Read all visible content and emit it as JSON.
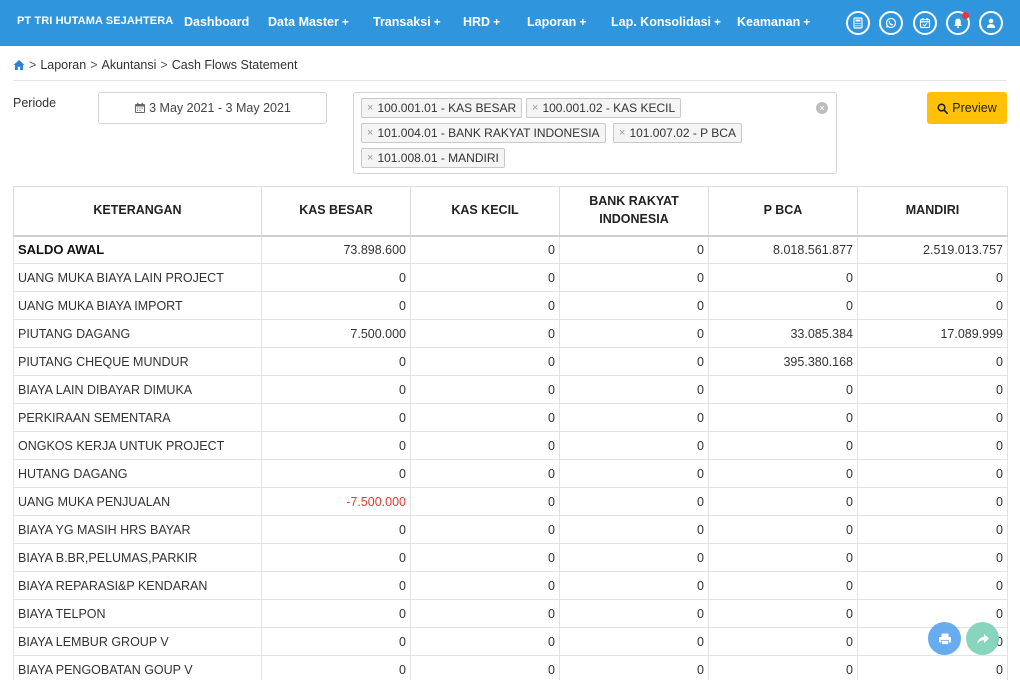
{
  "navbar": {
    "brand": "PT TRI HUTAMA SEJAHTERA",
    "items": [
      {
        "label": "Dashboard",
        "plus": ""
      },
      {
        "label": "Data Master",
        "plus": "+"
      },
      {
        "label": "Transaksi",
        "plus": "+"
      },
      {
        "label": "HRD",
        "plus": "+"
      },
      {
        "label": "Laporan",
        "plus": "+"
      },
      {
        "label": "Lap. Konsolidasi",
        "plus": "+"
      },
      {
        "label": "Keamanan",
        "plus": "+"
      }
    ],
    "icons": [
      "calculator-icon",
      "whatsapp-icon",
      "calendar-check-icon",
      "bell-icon",
      "user-icon"
    ]
  },
  "breadcrumb": {
    "home_icon": "home-icon",
    "items": [
      "Laporan",
      "Akuntansi",
      "Cash Flows Statement"
    ],
    "separator": ">"
  },
  "filters": {
    "periode_label": "Periode",
    "date_range": "3 May 2021 - 3 May 2021",
    "accounts": [
      "100.001.01 - KAS BESAR",
      "100.001.02 - KAS KECIL",
      "101.004.01 - BANK RAKYAT INDONESIA",
      "101.007.02 - P BCA",
      "101.008.01 - MANDIRI"
    ],
    "remove_symbol": "×",
    "clear_symbol": "×",
    "preview_label": "Preview"
  },
  "table": {
    "headers": [
      "KETERANGAN",
      "KAS BESAR",
      "KAS KECIL",
      "BANK RAKYAT INDONESIA",
      "P BCA",
      "MANDIRI"
    ],
    "rows": [
      {
        "label": "SALDO AWAL",
        "values": [
          "73.898.600",
          "0",
          "0",
          "8.018.561.877",
          "2.519.013.757"
        ],
        "bold": true
      },
      {
        "label": "UANG MUKA BIAYA LAIN PROJECT",
        "values": [
          "0",
          "0",
          "0",
          "0",
          "0"
        ]
      },
      {
        "label": "UANG MUKA BIAYA IMPORT",
        "values": [
          "0",
          "0",
          "0",
          "0",
          "0"
        ]
      },
      {
        "label": "PIUTANG DAGANG",
        "values": [
          "7.500.000",
          "0",
          "0",
          "33.085.384",
          "17.089.999"
        ]
      },
      {
        "label": "PIUTANG CHEQUE MUNDUR",
        "values": [
          "0",
          "0",
          "0",
          "395.380.168",
          "0"
        ]
      },
      {
        "label": "BIAYA LAIN DIBAYAR DIMUKA",
        "values": [
          "0",
          "0",
          "0",
          "0",
          "0"
        ]
      },
      {
        "label": "PERKIRAAN SEMENTARA",
        "values": [
          "0",
          "0",
          "0",
          "0",
          "0"
        ]
      },
      {
        "label": "ONGKOS KERJA UNTUK PROJECT",
        "values": [
          "0",
          "0",
          "0",
          "0",
          "0"
        ]
      },
      {
        "label": "HUTANG DAGANG",
        "values": [
          "0",
          "0",
          "0",
          "0",
          "0"
        ]
      },
      {
        "label": "UANG MUKA PENJUALAN",
        "values": [
          "-7.500.000",
          "0",
          "0",
          "0",
          "0"
        ]
      },
      {
        "label": "BIAYA YG MASIH HRS BAYAR",
        "values": [
          "0",
          "0",
          "0",
          "0",
          "0"
        ]
      },
      {
        "label": "BIAYA B.BR,PELUMAS,PARKIR",
        "values": [
          "0",
          "0",
          "0",
          "0",
          "0"
        ]
      },
      {
        "label": "BIAYA REPARASI&P KENDARAN",
        "values": [
          "0",
          "0",
          "0",
          "0",
          "0"
        ]
      },
      {
        "label": "BIAYA TELPON",
        "values": [
          "0",
          "0",
          "0",
          "0",
          "0"
        ]
      },
      {
        "label": "BIAYA LEMBUR GROUP V",
        "values": [
          "0",
          "0",
          "0",
          "0",
          "0"
        ]
      },
      {
        "label": "BIAYA PENGOBATAN GOUP V",
        "values": [
          "0",
          "0",
          "0",
          "0",
          "0"
        ]
      }
    ]
  },
  "fabs": [
    "print-icon",
    "share-icon"
  ],
  "colors": {
    "navbar": "#2f95dc",
    "preview": "#ffc107",
    "negative": "#e53935"
  }
}
